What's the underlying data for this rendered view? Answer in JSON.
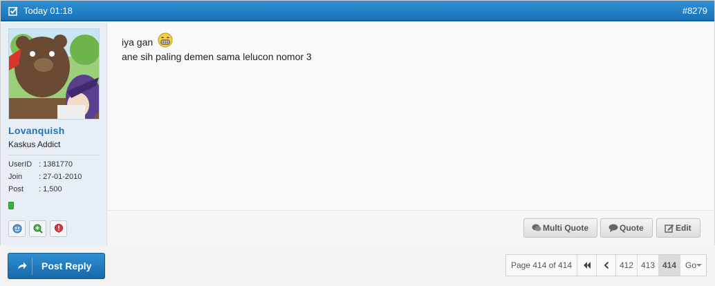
{
  "post": {
    "timestamp": "Today 01:18",
    "number": "#8279",
    "message_line1": "iya gan",
    "message_line2": "ane sih paling demen sama lelucon nomor 3"
  },
  "user": {
    "name": "Lovanquish",
    "rank": "Kaskus Addict",
    "userid_label": "UserID",
    "userid_value": ": 1381770",
    "join_label": "Join",
    "join_value": ": 27-01-2010",
    "post_label": "Post",
    "post_value": ": 1,500",
    "icons": [
      "profile-icon",
      "add-friend-icon",
      "report-icon"
    ]
  },
  "actions": {
    "multi_quote": "Multi Quote",
    "quote": "Quote",
    "edit": "Edit"
  },
  "footer": {
    "post_reply": "Post Reply",
    "page_info": "Page 414 of 414",
    "pages": [
      "412",
      "413",
      "414"
    ],
    "current_page": "414",
    "go": "Go"
  },
  "colors": {
    "header_blue": "#1a73b8",
    "username_blue": "#1e75b6",
    "reputation_green": "#3cb043"
  }
}
